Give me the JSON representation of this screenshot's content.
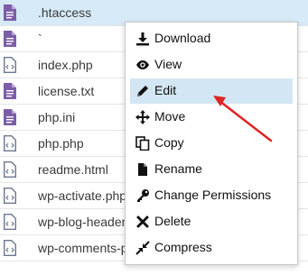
{
  "files": [
    {
      "name": ".htaccess",
      "icon": "text-doc-icon",
      "selected": true
    },
    {
      "name": "`",
      "icon": "text-doc-icon",
      "selected": false
    },
    {
      "name": "index.php",
      "icon": "code-file-icon",
      "selected": false
    },
    {
      "name": "license.txt",
      "icon": "text-doc-icon",
      "selected": false
    },
    {
      "name": "php.ini",
      "icon": "text-doc-icon",
      "selected": false
    },
    {
      "name": "php.php",
      "icon": "code-file-icon",
      "selected": false
    },
    {
      "name": "readme.html",
      "icon": "code-file-icon",
      "selected": false
    },
    {
      "name": "wp-activate.php",
      "icon": "code-file-icon",
      "selected": false
    },
    {
      "name": "wp-blog-header.php",
      "icon": "code-file-icon",
      "selected": false
    },
    {
      "name": "wp-comments-post.php",
      "icon": "code-file-icon",
      "selected": false
    }
  ],
  "context_menu": {
    "items": [
      {
        "label": "Download",
        "icon": "download-icon"
      },
      {
        "label": "View",
        "icon": "eye-icon"
      },
      {
        "label": "Edit",
        "icon": "pencil-icon",
        "highlighted": true
      },
      {
        "label": "Move",
        "icon": "move-icon"
      },
      {
        "label": "Copy",
        "icon": "copy-icon"
      },
      {
        "label": "Rename",
        "icon": "file-icon"
      },
      {
        "label": "Change Permissions",
        "icon": "key-icon"
      },
      {
        "label": "Delete",
        "icon": "delete-x-icon"
      },
      {
        "label": "Compress",
        "icon": "compress-icon"
      }
    ]
  },
  "colors": {
    "text_doc_icon": "#7b5ea7",
    "code_file_icon": "#6b7890",
    "selection": "#d6eaf8",
    "menu_highlight": "#d3e6f4",
    "annotation_arrow": "#e02424"
  }
}
